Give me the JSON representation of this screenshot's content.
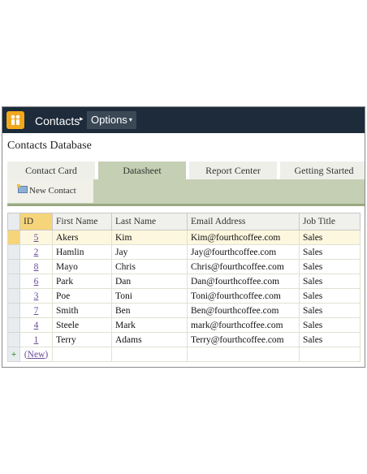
{
  "topbar": {
    "app_name": "Contacts",
    "options_label": "Options"
  },
  "db_title": "Contacts Database",
  "tabs": [
    {
      "label": "Contact Card",
      "active": false
    },
    {
      "label": "Datasheet",
      "active": true
    },
    {
      "label": "Report Center",
      "active": false
    },
    {
      "label": "Getting Started",
      "active": false
    }
  ],
  "toolbar": {
    "new_contact_label": "New Contact"
  },
  "table": {
    "columns": [
      "ID",
      "First Name",
      "Last Name",
      "Email Address",
      "Job Title"
    ],
    "rows": [
      {
        "id": "5",
        "first": "Akers",
        "last": "Kim",
        "email": "Kim@fourthcoffee.com",
        "title": "Sales"
      },
      {
        "id": "2",
        "first": "Hamlin",
        "last": "Jay",
        "email": "Jay@fourthcoffee.com",
        "title": "Sales"
      },
      {
        "id": "8",
        "first": "Mayo",
        "last": "Chris",
        "email": "Chris@fourthcoffee.com",
        "title": "Sales"
      },
      {
        "id": "6",
        "first": "Park",
        "last": "Dan",
        "email": "Dan@fourthcoffee.com",
        "title": "Sales"
      },
      {
        "id": "3",
        "first": "Poe",
        "last": "Toni",
        "email": "Toni@fourthcoffee.com",
        "title": "Sales"
      },
      {
        "id": "7",
        "first": "Smith",
        "last": "Ben",
        "email": "Ben@fourthcoffee.com",
        "title": "Sales"
      },
      {
        "id": "4",
        "first": "Steele",
        "last": "Mark",
        "email": "mark@fourthcoffee.com",
        "title": "Sales"
      },
      {
        "id": "1",
        "first": "Terry",
        "last": "Adams",
        "email": "Terry@fourthcoffee.com",
        "title": "Sales"
      }
    ],
    "new_row_label": "(New)",
    "new_row_icon": "+"
  },
  "colors": {
    "topbar": "#1d2b3a",
    "active_tab": "#c5cfb4",
    "selected_row": "#f6d47a",
    "link": "#6a4a9a"
  },
  "icons": {
    "app_logo": "people-icon",
    "crumb_separator": "▸",
    "menu_caret": "▾",
    "new_contact": "contact-card-icon",
    "new_row": "plus-icon"
  }
}
